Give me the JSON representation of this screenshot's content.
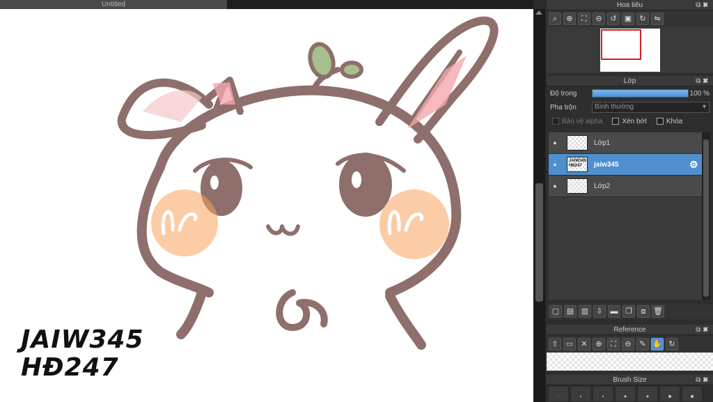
{
  "document": {
    "tab_title": "Untitled"
  },
  "canvas": {
    "watermark_line1": "JAIW345",
    "watermark_line2": "HĐ247"
  },
  "navigator": {
    "title": "Hoa tiêu"
  },
  "layers_panel": {
    "title": "Lớp",
    "opacity_label": "Độ trong",
    "opacity_value": "100 %",
    "opacity_fraction": 1.0,
    "blend_label": "Pha trộn",
    "blend_value": "Bình thường",
    "protect_alpha": "Bảo vệ alpha",
    "clipping": "Xén bớt",
    "lock": "Khóa",
    "layers": [
      {
        "name": "Lớp1",
        "selected": false
      },
      {
        "name": "jaiw345",
        "thumb_text": "JAIW345 HĐ247",
        "selected": true
      },
      {
        "name": "Lớp2",
        "selected": false
      }
    ]
  },
  "reference": {
    "title": "Reference"
  },
  "brush_size": {
    "title": "Brush Size"
  },
  "colors": {
    "accent": "#4f8fcf",
    "panel": "#2e2e2e",
    "canvas": "#ffffff"
  }
}
